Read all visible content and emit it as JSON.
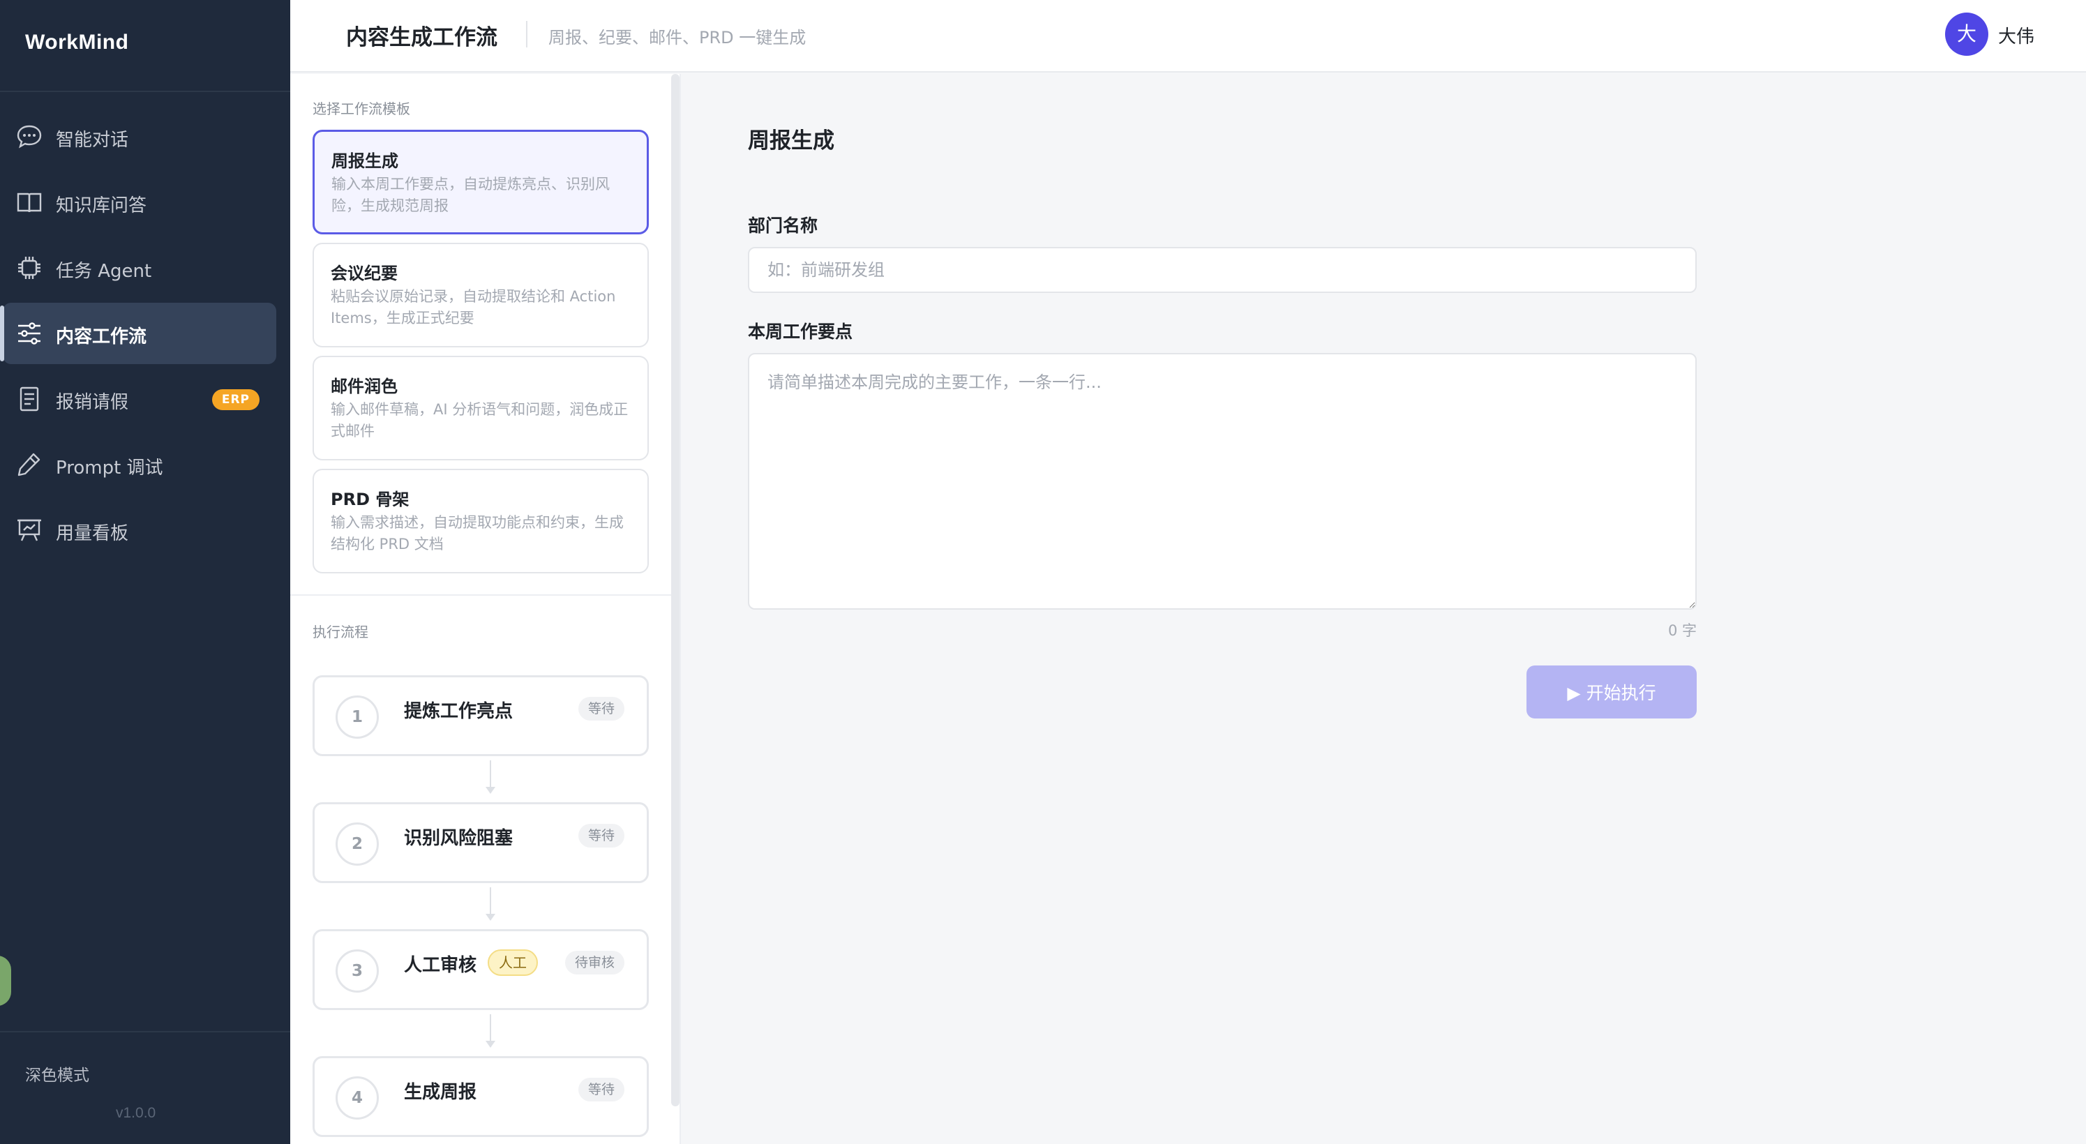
{
  "sidebar": {
    "brand": "WorkMind",
    "items": [
      {
        "label": "智能对话",
        "icon": "chat-bubble-icon"
      },
      {
        "label": "知识库问答",
        "icon": "book-icon"
      },
      {
        "label": "任务 Agent",
        "icon": "chip-icon"
      },
      {
        "label": "内容工作流",
        "icon": "sliders-icon",
        "active": true
      },
      {
        "label": "报销请假",
        "icon": "document-icon",
        "badge": "ERP"
      },
      {
        "label": "Prompt 调试",
        "icon": "pen-icon"
      },
      {
        "label": "用量看板",
        "icon": "presentation-board-icon"
      }
    ],
    "dark_mode_label": "深色模式",
    "version": "v1.0.0"
  },
  "header": {
    "title": "内容生成工作流",
    "subtitle": "周报、纪要、邮件、PRD 一键生成",
    "user": {
      "avatar_text": "大",
      "name": "大伟"
    }
  },
  "templates": {
    "section_label": "选择工作流模板",
    "items": [
      {
        "title": "周报生成",
        "desc": "输入本周工作要点，自动提炼亮点、识别风险，生成规范周报",
        "selected": true
      },
      {
        "title": "会议纪要",
        "desc": "粘贴会议原始记录，自动提取结论和 Action Items，生成正式纪要"
      },
      {
        "title": "邮件润色",
        "desc": "输入邮件草稿，AI 分析语气和问题，润色成正式邮件"
      },
      {
        "title": "PRD 骨架",
        "desc": "输入需求描述，自动提取功能点和约束，生成结构化 PRD 文档"
      }
    ]
  },
  "pipeline": {
    "section_label": "执行流程",
    "steps": [
      {
        "num": "1",
        "title": "提炼工作亮点",
        "status": "等待"
      },
      {
        "num": "2",
        "title": "识别风险阻塞",
        "status": "等待"
      },
      {
        "num": "3",
        "title": "人工审核",
        "tag": "人工",
        "status": "待审核"
      },
      {
        "num": "4",
        "title": "生成周报",
        "status": "等待"
      }
    ]
  },
  "form": {
    "title": "周报生成",
    "dept_label": "部门名称",
    "dept_placeholder": "如：前端研发组",
    "dept_value": "",
    "notes_label": "本周工作要点",
    "notes_placeholder": "请简单描述本周完成的主要工作，一条一行...",
    "notes_value": "",
    "char_count": "0 字",
    "run_button": "▶ 开始执行"
  },
  "colors": {
    "sidebar_bg": "#1f2a3c",
    "accent": "#4f46e5",
    "selected_border": "#5b5be6",
    "erp_badge": "#f5a524",
    "run_button_disabled": "#b4b4f3"
  }
}
